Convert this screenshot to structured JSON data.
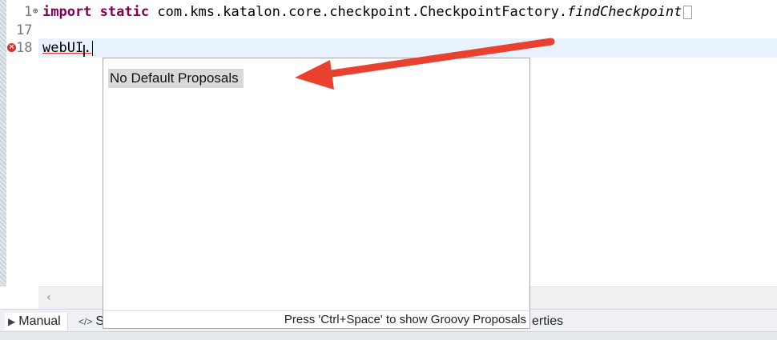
{
  "editor": {
    "lines": [
      {
        "number": "1",
        "fold_marker": "⊕",
        "keyword1": "import",
        "keyword2": "static",
        "code": "com.kms.katalon.core.checkpoint.CheckpointFactory.",
        "italic": "findCheckpoint"
      },
      {
        "number": "17"
      },
      {
        "number": "18",
        "has_error": true,
        "code": "webUI."
      }
    ],
    "error_icon": "error-icon",
    "cursor_icon": "i-beam-cursor-icon"
  },
  "content_assist": {
    "proposals": [
      "No Default Proposals"
    ],
    "status_text": "Press 'Ctrl+Space' to show Groovy Proposals"
  },
  "bottom_tabs": {
    "manual": {
      "label": "Manual",
      "icon": "manual-icon"
    },
    "script": {
      "label": "S",
      "icon": "code-tag-icon"
    },
    "properties": {
      "label": "erties"
    }
  },
  "scrollbar": {
    "left_arrow_icon": "chevron-left-icon"
  },
  "annotation": {
    "color": "#e8412f",
    "icon": "red-arrow-annotation"
  },
  "colors": {
    "keyword": "#7f0055",
    "current_line": "#e8f2fe",
    "error": "#d9302c",
    "selection": "#d9d9d9"
  }
}
